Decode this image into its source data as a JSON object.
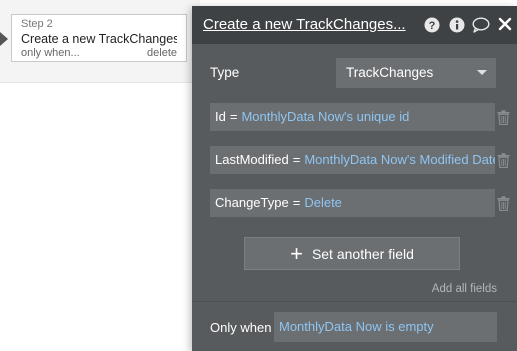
{
  "step": {
    "label": "Step 2",
    "title": "Create a new TrackChanges...",
    "condition": "only when...",
    "delete_label": "delete"
  },
  "panel": {
    "title": "Create a new TrackChanges...",
    "icons": [
      "help-icon",
      "info-icon",
      "comment-icon",
      "close-icon"
    ],
    "type_label": "Type",
    "type_value": "TrackChanges",
    "fields": [
      {
        "name": "Id",
        "eq": "=",
        "value": "MonthlyData Now's unique id"
      },
      {
        "name": "LastModified",
        "eq": "=",
        "value": "MonthlyData Now's Modified Date"
      },
      {
        "name": "ChangeType",
        "eq": "=",
        "value": "Delete"
      }
    ],
    "set_field_label": "Set another field",
    "add_all_label": "Add all fields",
    "only_when_label": "Only when",
    "only_when_value": "MonthlyData Now is empty"
  },
  "colors": {
    "panel_bg": "#585b5d",
    "header_bg": "#3e4245",
    "input_bg": "#6c6f72",
    "expression_text": "#8ec5f2"
  }
}
